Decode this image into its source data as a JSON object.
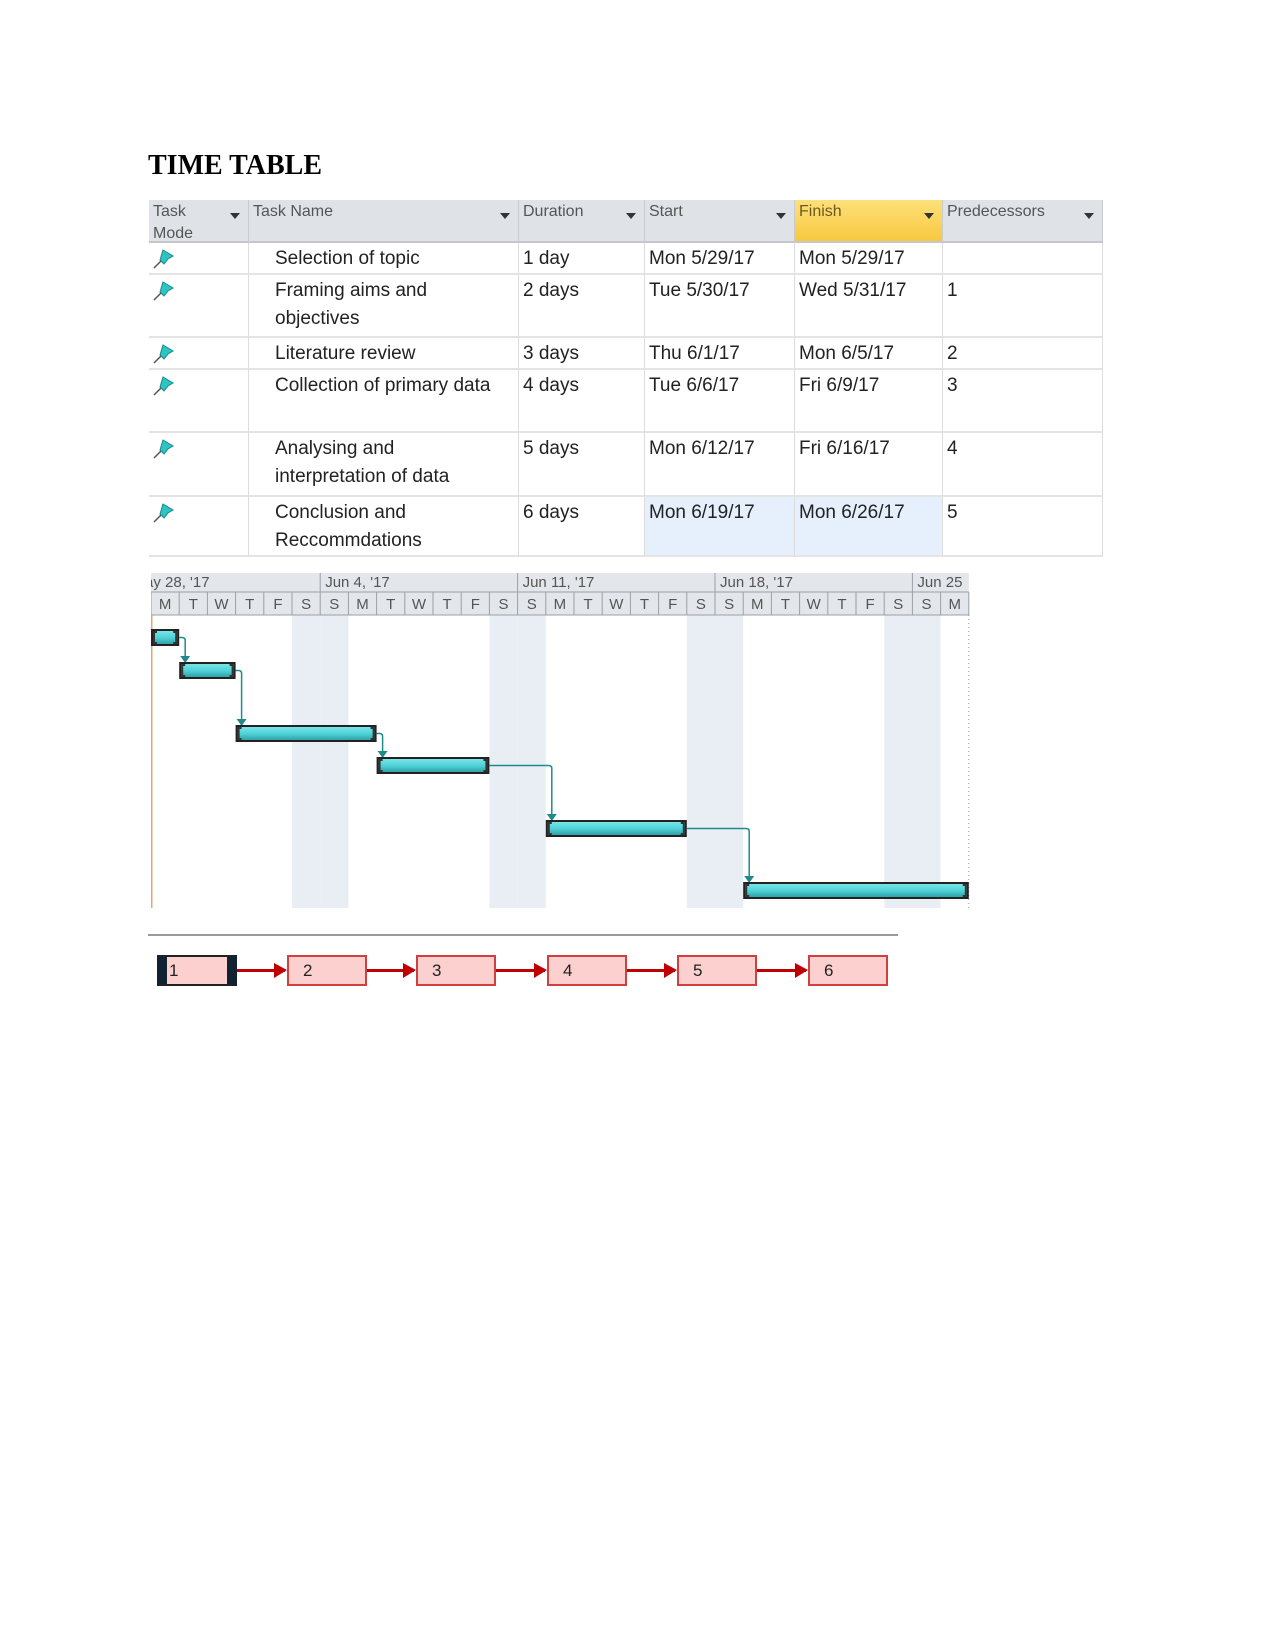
{
  "document": {
    "title": "TIME TABLE"
  },
  "table": {
    "columns": [
      {
        "label": "Task Mode"
      },
      {
        "label": "Task Name"
      },
      {
        "label": "Duration"
      },
      {
        "label": "Start"
      },
      {
        "label": "Finish",
        "selected": true
      },
      {
        "label": "Predecessors"
      }
    ],
    "rows": [
      {
        "mode_icon": "manual-pin-icon",
        "name": "Selection of topic",
        "duration": "1 day",
        "start": "Mon 5/29/17",
        "finish": "Mon 5/29/17",
        "predecessors": ""
      },
      {
        "mode_icon": "manual-pin-icon",
        "name": "Framing aims and objectives",
        "duration": "2 days",
        "start": "Tue 5/30/17",
        "finish": "Wed 5/31/17",
        "predecessors": "1"
      },
      {
        "mode_icon": "manual-pin-icon",
        "name": "Literature review",
        "duration": "3 days",
        "start": "Thu 6/1/17",
        "finish": "Mon 6/5/17",
        "predecessors": "2"
      },
      {
        "mode_icon": "manual-pin-icon",
        "name": "Collection of primary data",
        "duration": "4 days",
        "start": "Tue 6/6/17",
        "finish": "Fri 6/9/17",
        "predecessors": "3"
      },
      {
        "mode_icon": "manual-pin-icon",
        "name": "Analysing and interpretation of data",
        "duration": "5 days",
        "start": "Mon 6/12/17",
        "finish": "Fri 6/16/17",
        "predecessors": "4"
      },
      {
        "mode_icon": "manual-pin-icon",
        "name": "Conclusion and Reccommdations",
        "duration": "6 days",
        "start": "Mon 6/19/17",
        "finish": "Mon 6/26/17",
        "predecessors": "5",
        "highlight": true
      }
    ]
  },
  "gantt": {
    "weeks": [
      "ay 28, '17",
      "Jun 4, '17",
      "Jun 11, '17",
      "Jun 18, '17",
      "Jun 25"
    ],
    "days": [
      "M",
      "T",
      "W",
      "T",
      "F",
      "S",
      "S",
      "M",
      "T",
      "W",
      "T",
      "F",
      "S",
      "S",
      "M",
      "T",
      "W",
      "T",
      "F",
      "S",
      "S",
      "M",
      "T",
      "W",
      "T",
      "F",
      "S",
      "S",
      "M"
    ],
    "bars": [
      {
        "task": 1,
        "start_day": "5/29/17",
        "finish_day": "5/29/17"
      },
      {
        "task": 2,
        "start_day": "5/30/17",
        "finish_day": "5/31/17"
      },
      {
        "task": 3,
        "start_day": "6/1/17",
        "finish_day": "6/5/17"
      },
      {
        "task": 4,
        "start_day": "6/6/17",
        "finish_day": "6/9/17"
      },
      {
        "task": 5,
        "start_day": "6/12/17",
        "finish_day": "6/16/17"
      },
      {
        "task": 6,
        "start_day": "6/19/17",
        "finish_day": "6/26/17"
      }
    ],
    "colors": {
      "bar": "#4fd3d8",
      "link": "#1f8a8a",
      "weekend": "#e9eef5",
      "today": "#f0a070"
    }
  },
  "network": {
    "nodes": [
      "1",
      "2",
      "3",
      "4",
      "5",
      "6"
    ],
    "colors": {
      "box": "#fdd0d0",
      "border": "#d04040",
      "arrow": "#c00000"
    }
  }
}
